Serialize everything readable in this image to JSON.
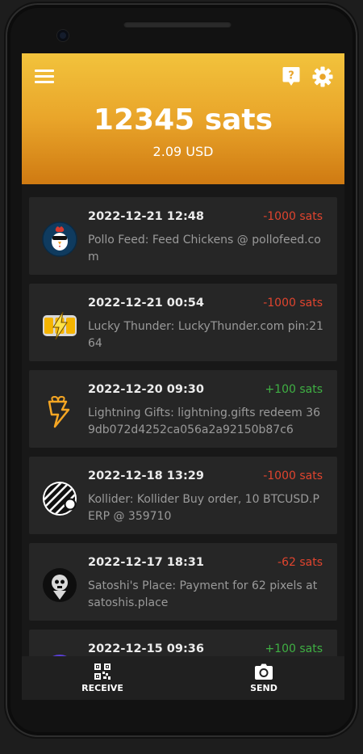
{
  "header": {
    "balance": "12345 sats",
    "fiat": "2.09 USD",
    "gradient_colors": [
      "#f2c33c",
      "#e9a52a",
      "#cf7a12"
    ],
    "icons": [
      "menu-icon",
      "help-icon",
      "gear-icon"
    ]
  },
  "transactions": [
    {
      "date": "2022-12-21 12:48",
      "amount": "-1000 sats",
      "description": "Pollo Feed: Feed Chickens @ pollofeed.com",
      "avatar": "pollo-feed-icon"
    },
    {
      "date": "2022-12-21 00:54",
      "amount": "-1000 sats",
      "description": "Lucky Thunder: LuckyThunder.com pin:2164",
      "avatar": "lucky-thunder-icon"
    },
    {
      "date": "2022-12-20 09:30",
      "amount": "+100 sats",
      "description": "Lightning Gifts: lightning.gifts redeem 369db072d4252ca056a2a92150b87c6",
      "avatar": "lightning-gifts-icon"
    },
    {
      "date": "2022-12-18 13:29",
      "amount": "-1000 sats",
      "description": "Kollider: Kollider Buy order, 10 BTCUSD.PERP @ 359710",
      "avatar": "kollider-icon"
    },
    {
      "date": "2022-12-17 18:31",
      "amount": "-62 sats",
      "description": "Satoshi's Place: Payment for 62 pixels at satoshis.place",
      "avatar": "satoshis-place-icon"
    },
    {
      "date": "2022-12-15 09:36",
      "amount": "+100 sats",
      "description": "",
      "avatar": "app-icon"
    }
  ],
  "colors": {
    "negative": "#e0442e",
    "positive": "#3fb043",
    "card": "#262626"
  },
  "bottom_nav": {
    "receive_label": "RECEIVE",
    "send_label": "SEND",
    "icons": [
      "qr-code-icon",
      "camera-icon"
    ]
  }
}
